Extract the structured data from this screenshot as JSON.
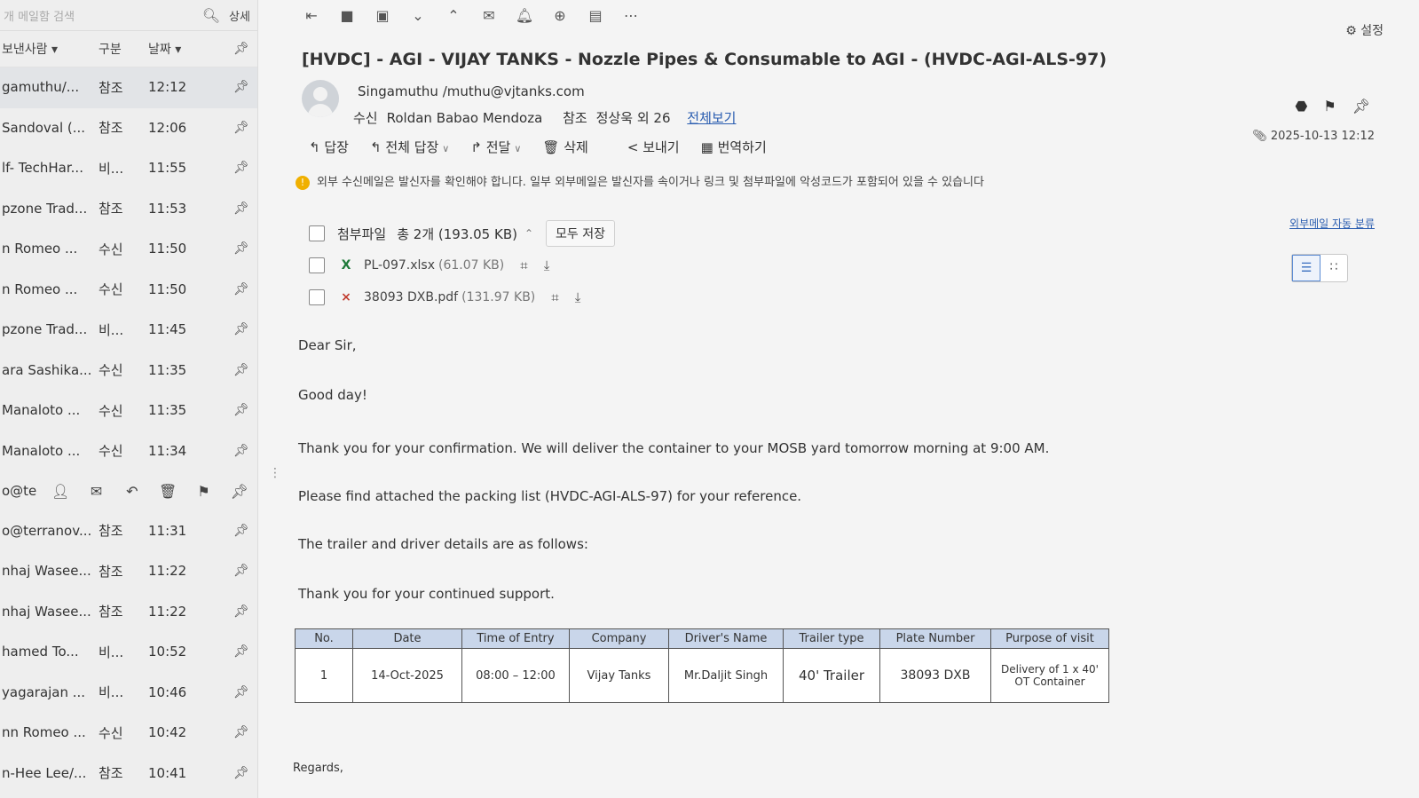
{
  "left_panel": {
    "search_placeholder": "개 메일함 검색",
    "detail_label": "상세",
    "headers": {
      "sender": "보낸사람 ▾",
      "kind": "구분",
      "date": "날짜 ▾"
    },
    "rows": [
      {
        "sender": "gamuthu/...",
        "kind": "참조",
        "time": "12:12"
      },
      {
        "sender": "Sandoval (...",
        "kind": "참조",
        "time": "12:06"
      },
      {
        "sender": "lf- TechHar...",
        "kind": "비...",
        "time": "11:55"
      },
      {
        "sender": "pzone Trad...",
        "kind": "참조",
        "time": "11:53"
      },
      {
        "sender": "n Romeo ...",
        "kind": "수신",
        "time": "11:50"
      },
      {
        "sender": "n Romeo ...",
        "kind": "수신",
        "time": "11:50"
      },
      {
        "sender": "pzone Trad...",
        "kind": "비...",
        "time": "11:45"
      },
      {
        "sender": "ara Sashika...",
        "kind": "수신",
        "time": "11:35"
      },
      {
        "sender": "Manaloto ...",
        "kind": "수신",
        "time": "11:35"
      },
      {
        "sender": "Manaloto ...",
        "kind": "수신",
        "time": "11:34"
      }
    ],
    "action_row_sender": "o@te",
    "rows2": [
      {
        "sender": "o@terranov...",
        "kind": "참조",
        "time": "11:31"
      },
      {
        "sender": "nhaj Wasee...",
        "kind": "참조",
        "time": "11:22"
      },
      {
        "sender": "nhaj Wasee...",
        "kind": "참조",
        "time": "11:22"
      },
      {
        "sender": "hamed To...",
        "kind": "비...",
        "time": "10:52"
      },
      {
        "sender": "yagarajan ...",
        "kind": "비...",
        "time": "10:46"
      },
      {
        "sender": "nn Romeo ...",
        "kind": "수신",
        "time": "10:42"
      },
      {
        "sender": "n-Hee Lee/...",
        "kind": "참조",
        "time": "10:41"
      }
    ]
  },
  "email": {
    "settings_label": "설정",
    "subject": "[HVDC] - AGI - VIJAY TANKS - Nozzle Pipes & Consumable to AGI - (HVDC-AGI-ALS-97)",
    "from": "Singamuthu /muthu@vjtanks.com",
    "to_label": "수신",
    "to": "Roldan Babao Mendoza",
    "cc_label": "참조",
    "cc": "정상욱 외 26",
    "view_all": "전체보기",
    "date": "2025-10-13 12:12",
    "auto_classify": "외부메일 자동 분류",
    "actions": {
      "reply": "답장",
      "reply_all": "전체 답장",
      "forward": "전달",
      "delete": "삭제",
      "send": "보내기",
      "translate": "번역하기"
    },
    "warning": "외부 수신메일은 발신자를 확인해야 합니다. 일부 외부메일은 발신자를 속이거나 링크 및 첨부파일에 악성코드가 포함되어 있을 수 있습니다",
    "attachments_label": "첨부파일",
    "attachments_summary": "총 2개 (193.05 KB)",
    "save_all": "모두 저장",
    "attachments": [
      {
        "name": "PL-097.xlsx",
        "size": "(61.07 KB)"
      },
      {
        "name": "38093 DXB.pdf",
        "size": "(131.97 KB)"
      }
    ],
    "body": {
      "greeting": "Dear Sir,",
      "line1": "Good day!",
      "line2": "Thank you for your confirmation. We will deliver the container to your MOSB yard tomorrow morning at 9:00 AM.",
      "line3": "Please find attached the packing list (HVDC-AGI-ALS-97) for your reference.",
      "line4": "The trailer and driver details are as follows:",
      "line5": "Thank you for your continued support.",
      "regards": "Regards,"
    },
    "table": {
      "headers": [
        "No.",
        "Date",
        "Time of Entry",
        "Company",
        "Driver's Name",
        "Trailer type",
        "Plate Number",
        "Purpose of visit"
      ],
      "row": [
        "1",
        "14-Oct-2025",
        "08:00 – 12:00",
        "Vijay Tanks",
        "Mr.Daljit Singh",
        "40' Trailer",
        "38093 DXB",
        "Delivery of 1 x 40' OT Container"
      ]
    }
  }
}
